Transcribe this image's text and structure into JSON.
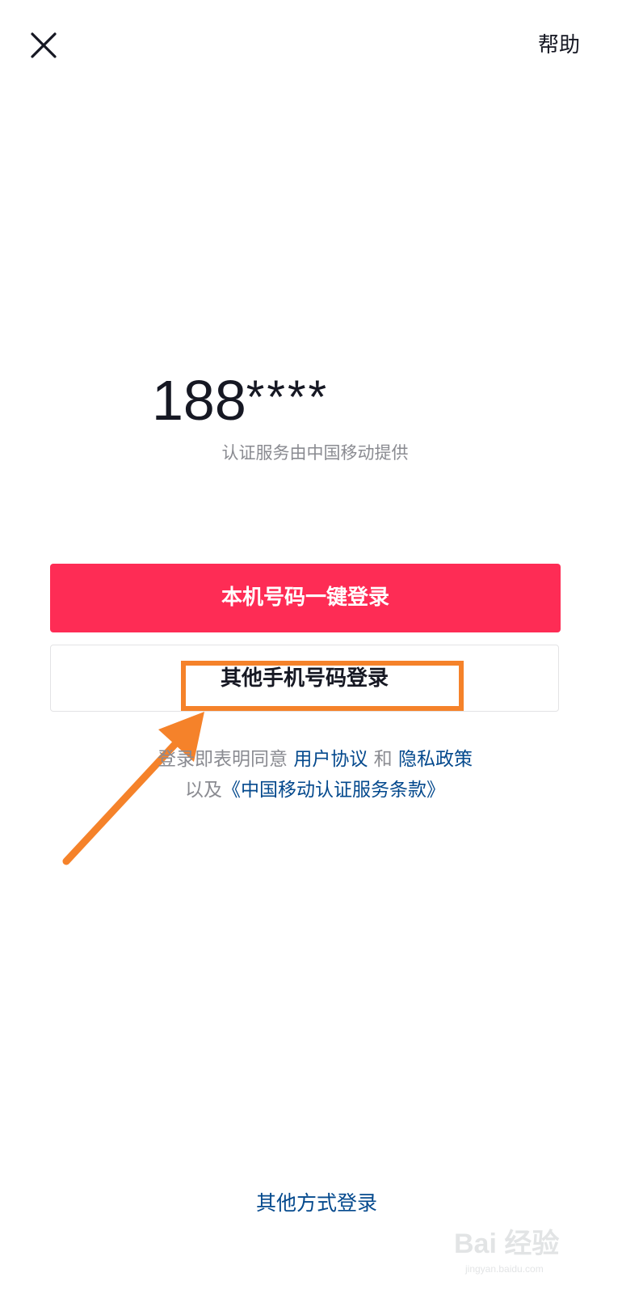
{
  "header": {
    "close_icon": "close-icon",
    "help_label": "帮助"
  },
  "login": {
    "phone_prefix": "188",
    "phone_masked": "****",
    "provider_note": "认证服务由中国移动提供",
    "one_tap_label": "本机号码一键登录",
    "other_phone_label": "其他手机号码登录"
  },
  "terms": {
    "prefix": "登录即表明同意",
    "user_agreement": "用户协议",
    "conjunction": "和",
    "privacy_policy": "隐私政策",
    "line2_prefix": "以及",
    "cmcc_terms": "《中国移动认证服务条款》"
  },
  "footer": {
    "other_methods_label": "其他方式登录"
  },
  "annotation": {
    "highlight_color": "#f5822a",
    "arrow_color": "#f5822a"
  },
  "watermark": {
    "logo_text": "Bai 经验",
    "url_text": "jingyan.baidu.com"
  },
  "colors": {
    "primary": "#fe2c55",
    "link": "#04498d",
    "muted": "#8a8b91"
  }
}
